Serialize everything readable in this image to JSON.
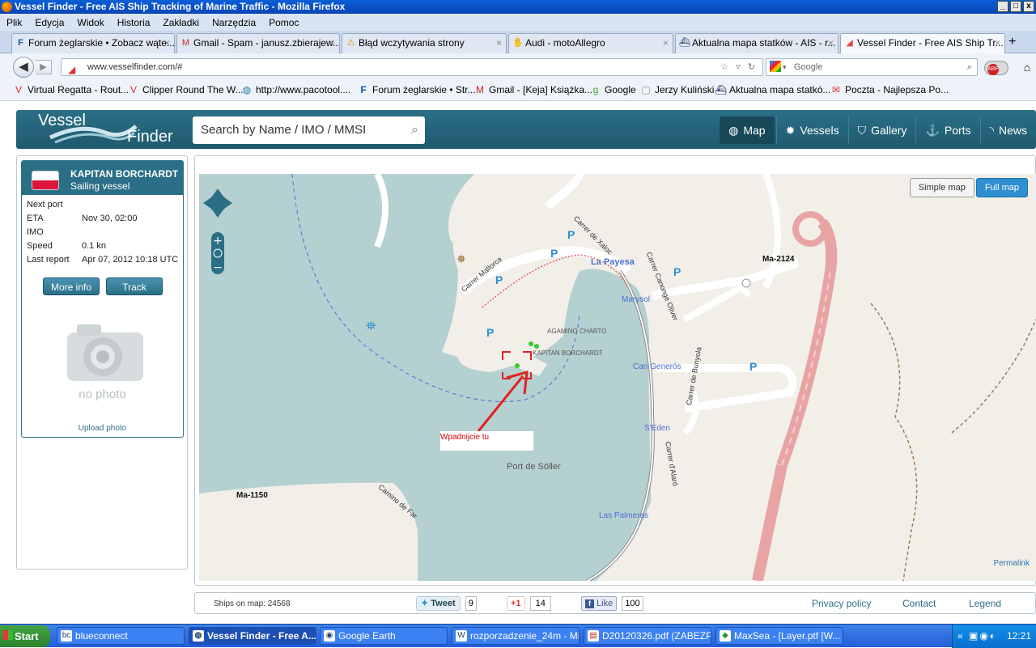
{
  "window": {
    "title": "Vessel Finder - Free AIS Ship Tracking of Marine Traffic - Mozilla Firefox"
  },
  "menu": [
    "Plik",
    "Edycja",
    "Widok",
    "Historia",
    "Zakładki",
    "Narzędzia",
    "Pomoc"
  ],
  "tabs": [
    {
      "label": "Forum żeglarskie • Zobacz wąte...",
      "icon": "fz-icon"
    },
    {
      "label": "Gmail - Spam - janusz.zbierajew...",
      "icon": "gmail-icon"
    },
    {
      "label": "Błąd wczytywania strony",
      "icon": "warning-icon"
    },
    {
      "label": "Audi - motoAllegro",
      "icon": "hand-icon"
    },
    {
      "label": "Aktualna mapa statków - AIS - r...",
      "icon": "ship-icon"
    },
    {
      "label": "Vessel Finder - Free AIS Ship Tr...",
      "icon": "vf-icon"
    }
  ],
  "nav": {
    "url": "www.vesselfinder.com/#",
    "search_placeholder": "Google",
    "abp": "ABP"
  },
  "bookmarks": [
    {
      "label": "Virtual Regatta - Rout..."
    },
    {
      "label": "Clipper Round The W..."
    },
    {
      "label": "http://www.pacotool...."
    },
    {
      "label": "Forum żeglarskie • Str..."
    },
    {
      "label": "Gmail - [Keja] Książka..."
    },
    {
      "label": "Google"
    },
    {
      "label": "Jerzy Kuliński"
    },
    {
      "label": "Aktualna mapa statkó..."
    },
    {
      "label": "Poczta - Najlepsza Po..."
    }
  ],
  "site": {
    "logo_top": "Vessel",
    "logo_bottom": "Finder",
    "search_placeholder": "Search by Name / IMO / MMSI",
    "nav": [
      "Map",
      "Vessels",
      "Gallery",
      "Ports",
      "News"
    ]
  },
  "vessel": {
    "name": "KAPITAN BORCHARDT",
    "type": "Sailing vessel",
    "fields": [
      {
        "k": "Next port",
        "v": ""
      },
      {
        "k": "ETA",
        "v": "Nov 30, 02:00"
      },
      {
        "k": "IMO",
        "v": ""
      },
      {
        "k": "Speed",
        "v": "0.1 kn"
      },
      {
        "k": "Last report",
        "v": "Apr 07, 2012 10:18 UTC"
      }
    ],
    "more_info": "More info",
    "track": "Track",
    "no_photo": "no photo",
    "upload": "Upload photo"
  },
  "map": {
    "simple": "Simple map",
    "full": "Full map",
    "permalink": "Permalink",
    "labels": {
      "la_payesa": "La Payesa",
      "ma2124": "Ma-2124",
      "marysol": "Marysol",
      "carrer_xaloc": "Carrer de Xaloc",
      "carrer_mallorca": "Carrer Mallorca",
      "carrer_canonge": "Carrer Canonge Oliver",
      "agamino": "AGAMINO CHARTO",
      "kapitan": "KAPITAN BORCHARDT",
      "can_generos": "Can Generós",
      "seden": "S'Eden",
      "carrer_bunyola": "Carrer de Bunyola",
      "carrer_alaro": "Carrer d'Alaró",
      "port_soller": "Port de Sóller",
      "ma1150": "Ma-1150",
      "camino_far": "Camino de Far",
      "las_palmeras": "Las Palmeras",
      "annotation": "Wpadnijcie tu"
    }
  },
  "footer": {
    "ships": "Ships on map: 24568",
    "tweet": "Tweet",
    "tweet_count": "9",
    "plus": "+1",
    "plus_count": "14",
    "like": "Like",
    "like_count": "100",
    "privacy": "Privacy policy",
    "contact": "Contact",
    "legend": "Legend"
  },
  "taskbar": {
    "start": "Start",
    "tasks": [
      "blueconnect",
      "Vessel Finder - Free A...",
      "Google Earth",
      "rozporzadzenie_24m - Mi...",
      "D20120326.pdf (ZABEZP...",
      "MaxSea - [Layer.ptf [W..."
    ],
    "time": "12:21"
  }
}
